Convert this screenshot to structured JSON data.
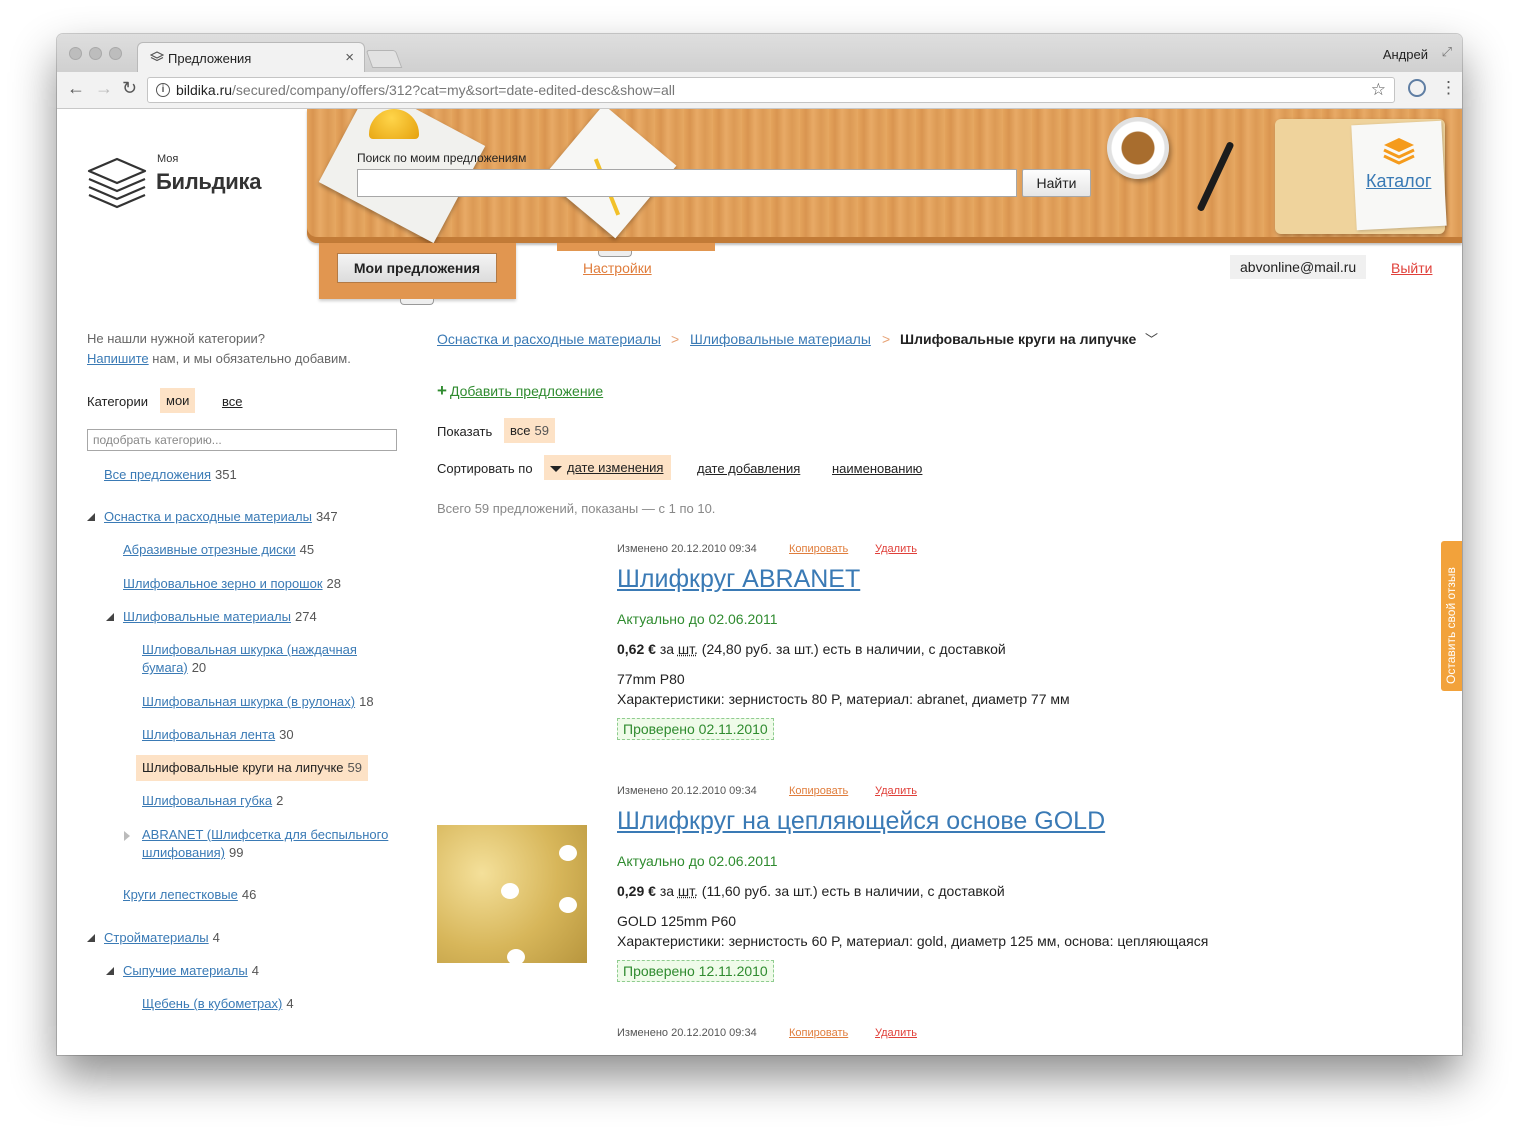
{
  "browser": {
    "tab_title": "Предложения",
    "profile_name": "Андрей",
    "url_host": "bildika.ru",
    "url_path": "/secured/company/offers/312?cat=my&sort=date-edited-desc&show=all"
  },
  "header": {
    "logo_small": "Моя",
    "logo_big": "Бильдика",
    "search_label": "Поиск по моим предложениям",
    "search_value": "",
    "search_button": "Найти",
    "catalog_link": "Каталог",
    "my_offers_tab": "Мои предложения",
    "settings_link": "Настройки",
    "user_email": "abvonline@mail.ru",
    "logout_link": "Выйти"
  },
  "sidebar": {
    "hint_line1": "Не нашли нужной категории?",
    "hint_link": "Напишите",
    "hint_line2_rest": " нам, и мы обязательно добавим.",
    "categories_label": "Категории",
    "filter_mine": "мои",
    "filter_all": "все",
    "filter_placeholder": "подобрать категорию...",
    "tree": [
      {
        "label": "Все предложения",
        "count": "351"
      },
      {
        "label": "Оснастка и расходные материалы",
        "count": "347"
      },
      {
        "label": "Абразивные отрезные диски",
        "count": "45"
      },
      {
        "label": "Шлифовальное зерно и порошок",
        "count": "28"
      },
      {
        "label": "Шлифовальные материалы",
        "count": "274"
      },
      {
        "label": "Шлифовальная шкурка (наждачная",
        "label2": "бумага)",
        "count": "20"
      },
      {
        "label": "Шлифовальная шкурка (в рулонах)",
        "count": "18"
      },
      {
        "label": "Шлифовальная лента",
        "count": "30"
      },
      {
        "label": "Шлифовальные круги на липучке",
        "count": "59"
      },
      {
        "label": "Шлифовальная губка",
        "count": "2"
      },
      {
        "label": "ABRANET (Шлифсетка для беспыльного",
        "label2": "шлифования)",
        "count": "99"
      },
      {
        "label": "Круги лепестковые",
        "count": "46"
      },
      {
        "label": "Стройматериалы",
        "count": "4"
      },
      {
        "label": "Сыпучие материалы",
        "count": "4"
      },
      {
        "label": "Щебень (в кубометрах)",
        "count": "4"
      }
    ]
  },
  "main": {
    "breadcrumb": [
      "Оснастка и расходные материалы",
      "Шлифовальные материалы"
    ],
    "breadcrumb_sep": ">",
    "breadcrumb_current": "Шлифовальные круги на липучке",
    "add_offer": "Добавить предложение",
    "show_label": "Показать",
    "show_all": "все",
    "show_count": "59",
    "sort_label": "Сортировать по",
    "sort_options": [
      "дате изменения",
      "дате добавления",
      "наименованию"
    ],
    "total": "Всего 59 предложений, показаны — с 1 по 10.",
    "feedback_tab": "Оставить свой отзыв"
  },
  "offers": [
    {
      "meta": "Изменено 20.12.2010 09:34",
      "copy": "Копировать",
      "delete": "Удалить",
      "title": "Шлифкруг ABRANET",
      "valid": "Актуально до 02.06.2011",
      "price": "0,62 €",
      "price_pre_unit": " за ",
      "price_unit": "шт.",
      "price_rest": " (24,80 руб. за шт.) есть в наличии, с доставкой",
      "name": "77mm P80",
      "specs": "Характеристики: зернистость 80 P, материал: abranet, диаметр 77 мм",
      "checked": "Проверено 02.11.2010"
    },
    {
      "meta": "Изменено 20.12.2010 09:34",
      "copy": "Копировать",
      "delete": "Удалить",
      "title": "Шлифкруг на цепляющейся основе GOLD",
      "valid": "Актуально до 02.06.2011",
      "price": "0,29 €",
      "price_pre_unit": " за ",
      "price_unit": "шт.",
      "price_rest": " (11,60 руб. за шт.) есть в наличии, с доставкой",
      "name": "GOLD 125mm P60",
      "specs": "Характеристики: зернистость 60 P, материал: gold, диаметр 125 мм, основа: цепляющаяся",
      "checked": "Проверено 12.11.2010"
    },
    {
      "meta": "Изменено 20.12.2010 09:34",
      "copy": "Копировать",
      "delete": "Удалить"
    }
  ]
}
